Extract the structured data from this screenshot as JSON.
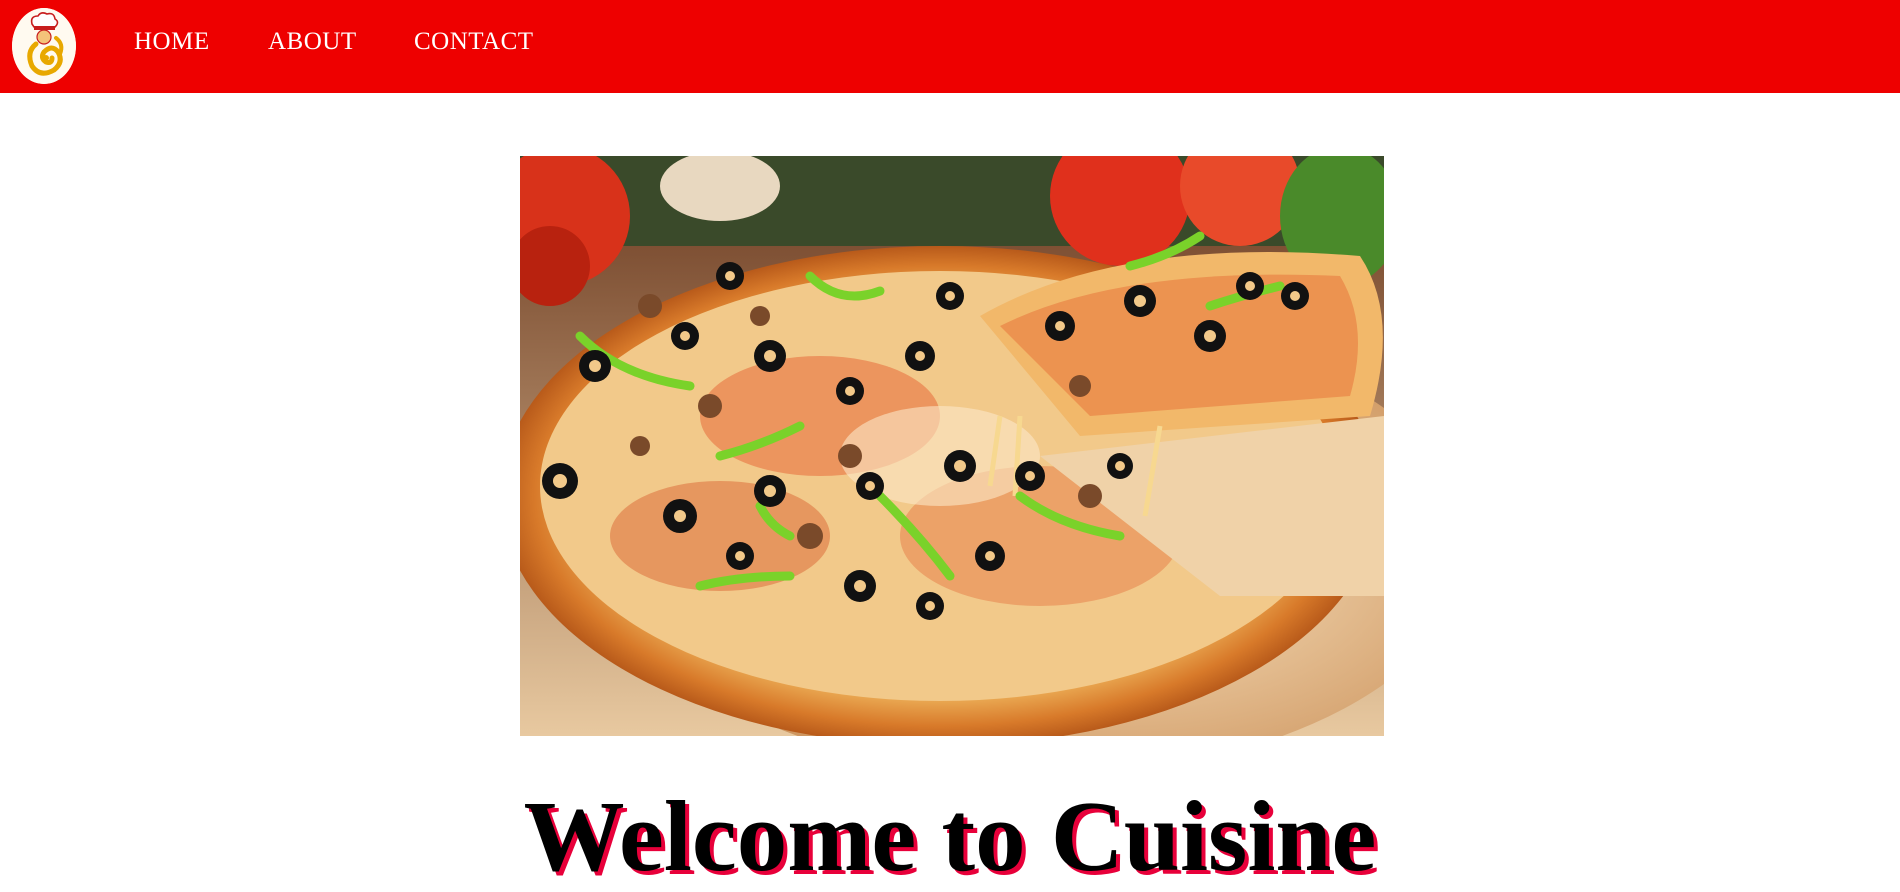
{
  "nav": {
    "links": [
      {
        "label": "HOME"
      },
      {
        "label": "ABOUT"
      },
      {
        "label": "CONTACT"
      }
    ]
  },
  "hero": {
    "heading": "Welcome to Cuisine"
  },
  "colors": {
    "navbar": "#ee0000",
    "nav_text": "#ffffff",
    "heading_text": "#000000",
    "heading_shadow": "#e8003a",
    "logo_gold": "#e8a800"
  },
  "icons": {
    "logo": "chef-logo-icon",
    "hero_image": "pizza-photo"
  }
}
